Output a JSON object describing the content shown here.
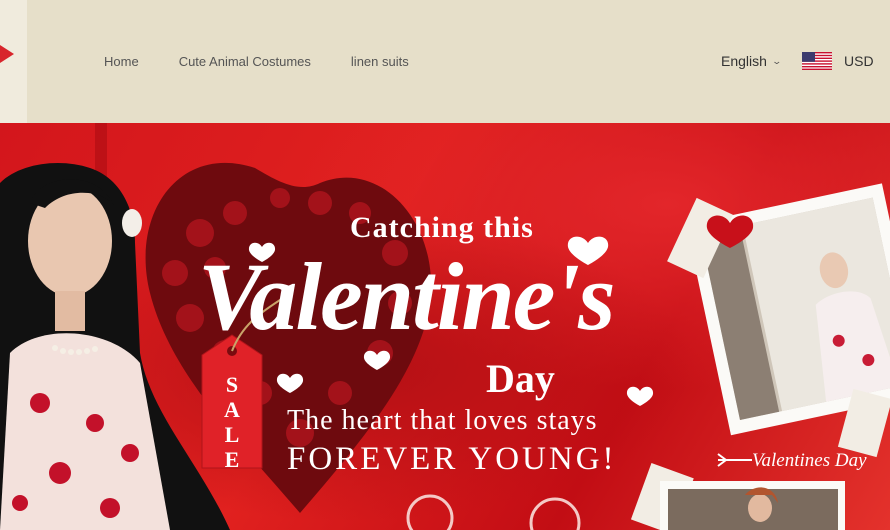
{
  "nav": {
    "items": [
      {
        "label": "Home"
      },
      {
        "label": "Cute Animal Costumes"
      },
      {
        "label": "linen suits"
      }
    ]
  },
  "header": {
    "language": "English",
    "currency": "USD"
  },
  "hero": {
    "headline_top": "Catching this",
    "headline_script": "Valentine's",
    "headline_day": "Day",
    "tag_text": "SALE",
    "tagline_1": "The heart that loves stays",
    "tagline_2": "FOREVER YOUNG!",
    "corner_label": "Valentines Day"
  },
  "colors": {
    "header_bg": "#e6dfc9",
    "hero_red": "#d3161c",
    "tag_red": "#e02228",
    "brand": "#d8252c"
  }
}
